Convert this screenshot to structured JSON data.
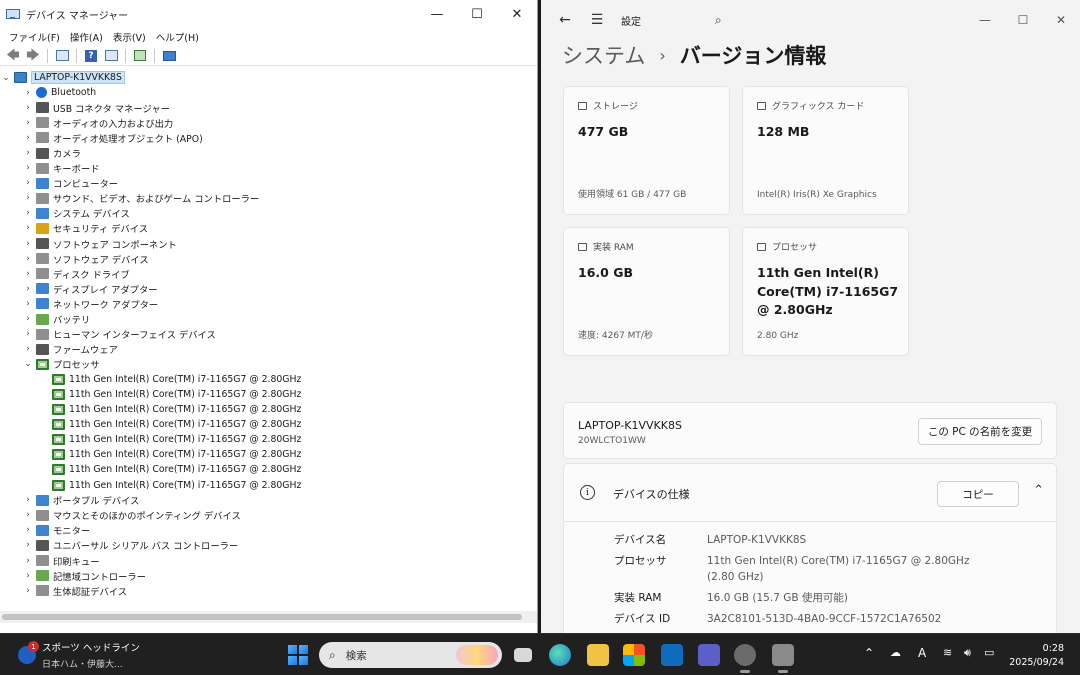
{
  "devmgr": {
    "title": "デバイス マネージャー",
    "menus": [
      "ファイル(F)",
      "操作(A)",
      "表示(V)",
      "ヘルプ(H)"
    ],
    "root": "LAPTOP-K1VVKK8S",
    "categories": [
      {
        "label": "Bluetooth",
        "icon": "bluetooth-icon"
      },
      {
        "label": "USB コネクタ マネージャー",
        "icon": "usb-icon"
      },
      {
        "label": "オーディオの入力および出力",
        "icon": "speaker-icon"
      },
      {
        "label": "オーディオ処理オブジェクト (APO)",
        "icon": "speaker-icon"
      },
      {
        "label": "カメラ",
        "icon": "camera-icon"
      },
      {
        "label": "キーボード",
        "icon": "keyboard-icon"
      },
      {
        "label": "コンピューター",
        "icon": "computer-icon"
      },
      {
        "label": "サウンド、ビデオ、およびゲーム コントローラー",
        "icon": "speaker-icon"
      },
      {
        "label": "システム デバイス",
        "icon": "system-device-icon"
      },
      {
        "label": "セキュリティ デバイス",
        "icon": "key-icon"
      },
      {
        "label": "ソフトウェア コンポーネント",
        "icon": "component-icon"
      },
      {
        "label": "ソフトウェア デバイス",
        "icon": "software-device-icon"
      },
      {
        "label": "ディスク ドライブ",
        "icon": "disk-icon"
      },
      {
        "label": "ディスプレイ アダプター",
        "icon": "display-icon"
      },
      {
        "label": "ネットワーク アダプター",
        "icon": "network-icon"
      },
      {
        "label": "バッテリ",
        "icon": "battery-icon"
      },
      {
        "label": "ヒューマン インターフェイス デバイス",
        "icon": "hid-icon"
      },
      {
        "label": "ファームウェア",
        "icon": "firmware-icon"
      },
      {
        "label": "プロセッサ",
        "icon": "processor-icon",
        "expanded": true,
        "children": [
          "11th Gen Intel(R) Core(TM) i7-1165G7 @ 2.80GHz",
          "11th Gen Intel(R) Core(TM) i7-1165G7 @ 2.80GHz",
          "11th Gen Intel(R) Core(TM) i7-1165G7 @ 2.80GHz",
          "11th Gen Intel(R) Core(TM) i7-1165G7 @ 2.80GHz",
          "11th Gen Intel(R) Core(TM) i7-1165G7 @ 2.80GHz",
          "11th Gen Intel(R) Core(TM) i7-1165G7 @ 2.80GHz",
          "11th Gen Intel(R) Core(TM) i7-1165G7 @ 2.80GHz",
          "11th Gen Intel(R) Core(TM) i7-1165G7 @ 2.80GHz"
        ]
      },
      {
        "label": "ポータブル デバイス",
        "icon": "portable-device-icon"
      },
      {
        "label": "マウスとそのほかのポインティング デバイス",
        "icon": "mouse-icon"
      },
      {
        "label": "モニター",
        "icon": "monitor-icon"
      },
      {
        "label": "ユニバーサル シリアル バス コントローラー",
        "icon": "usb-icon"
      },
      {
        "label": "印刷キュー",
        "icon": "printer-icon"
      },
      {
        "label": "記憶域コントローラー",
        "icon": "storage-controller-icon"
      },
      {
        "label": "生体認証デバイス",
        "icon": "fingerprint-icon"
      }
    ]
  },
  "settings": {
    "title": "設定",
    "breadcrumb": {
      "parent": "システム",
      "current": "バージョン情報"
    },
    "cards": {
      "storage": {
        "label": "ストレージ",
        "value": "477 GB",
        "sub": "使用領域 61 GB / 477 GB"
      },
      "graphics": {
        "label": "グラフィックス カード",
        "value": "128 MB",
        "sub": "Intel(R) Iris(R) Xe Graphics"
      },
      "ram": {
        "label": "実装 RAM",
        "value": "16.0 GB",
        "sub": "速度: 4267 MT/秒"
      },
      "cpu": {
        "label": "プロセッサ",
        "value": "11th Gen Intel(R) Core(TM) i7-1165G7 @ 2.80GHz",
        "sub": "2.80 GHz"
      }
    },
    "pc": {
      "name": "LAPTOP-K1VVKK8S",
      "model": "20WLCTO1WW",
      "rename_label": "この PC の名前を変更"
    },
    "device_spec": {
      "title": "デバイスの仕様",
      "copy_label": "コピー",
      "rows": [
        {
          "key": "デバイス名",
          "value": "LAPTOP-K1VVKK8S"
        },
        {
          "key": "プロセッサ",
          "value": "11th Gen Intel(R) Core(TM) i7-1165G7 @ 2.80GHz (2.80 GHz)"
        },
        {
          "key": "実装 RAM",
          "value": "16.0 GB (15.7 GB 使用可能)"
        },
        {
          "key": "デバイス ID",
          "value": "3A2C8101-513D-4BA0-9CCF-1572C1A76502"
        }
      ]
    }
  },
  "taskbar": {
    "news_badge": "1",
    "news_title": "スポーツ ヘッドライン",
    "news_sub": "日本ハム・伊藤大...",
    "search_placeholder": "検索",
    "clock_time": "0:28",
    "clock_date": "2025/09/24",
    "ime": "A"
  }
}
